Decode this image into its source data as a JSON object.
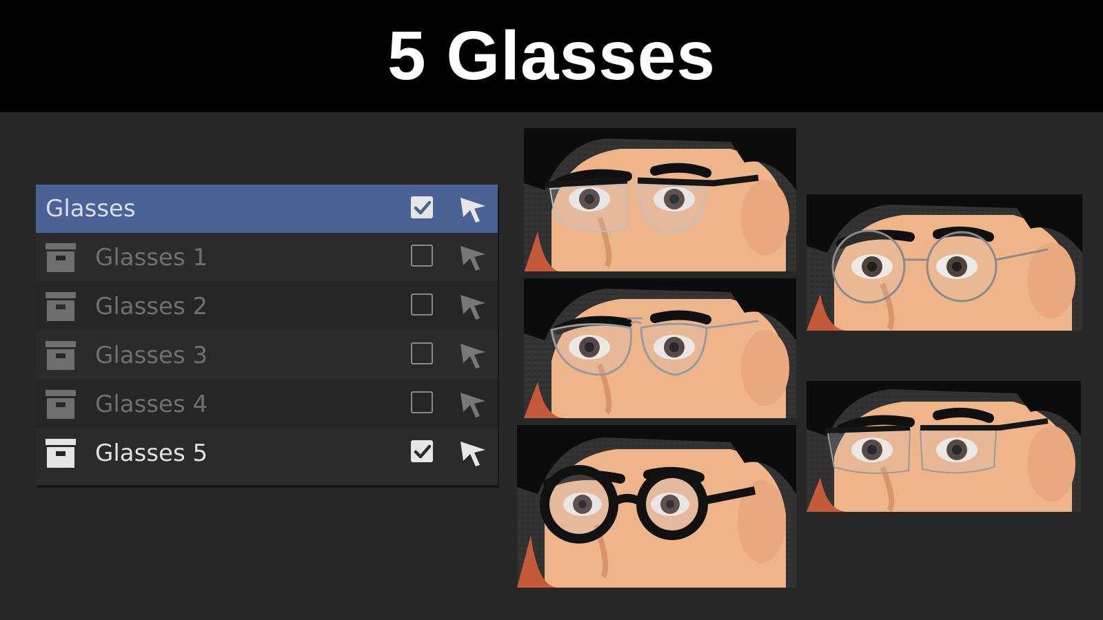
{
  "title": "5 Glasses",
  "outliner": {
    "collection": {
      "label": "Glasses",
      "visible": true
    },
    "items": [
      {
        "label": "Glasses 1",
        "visible": false
      },
      {
        "label": "Glasses 2",
        "visible": false
      },
      {
        "label": "Glasses 3",
        "visible": false
      },
      {
        "label": "Glasses 4",
        "visible": false
      },
      {
        "label": "Glasses 5",
        "visible": true
      }
    ],
    "icons": {
      "collection": "collection-box-icon",
      "select": "arrow-cursor-icon",
      "check": "checkmark-icon"
    }
  },
  "previews": [
    {
      "style": "browline"
    },
    {
      "style": "aviator"
    },
    {
      "style": "thick-round"
    },
    {
      "style": "thin-round"
    },
    {
      "style": "half-rim"
    }
  ],
  "colors": {
    "header_bg": "#000000",
    "background": "#272727",
    "selected_row": "#4a6295",
    "skin": "#f0b888",
    "hair": "#0c0c0c"
  }
}
